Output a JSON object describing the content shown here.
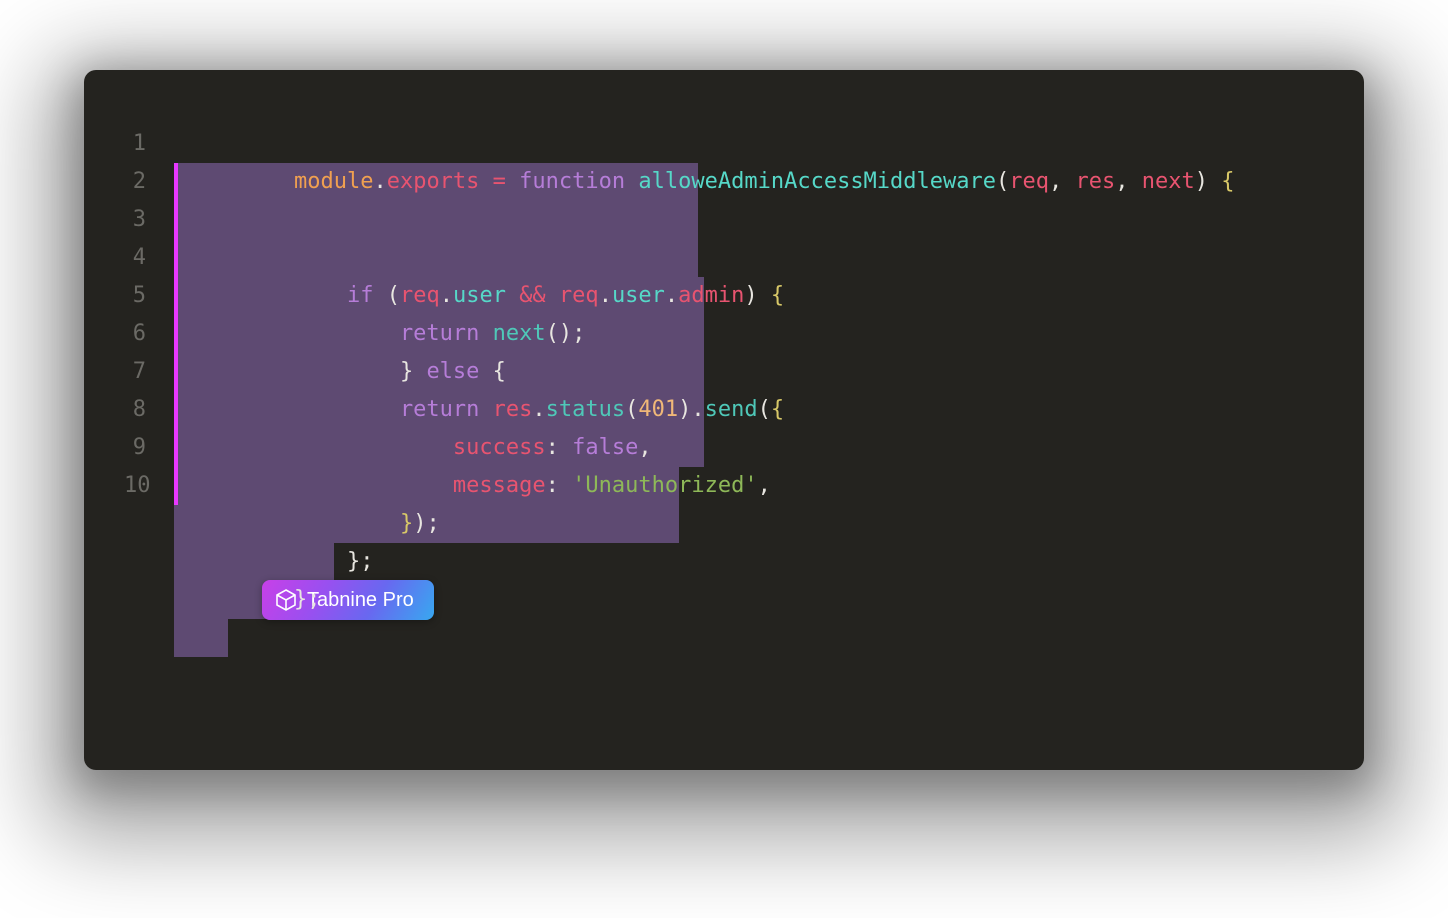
{
  "lineNumbers": [
    "1",
    "2",
    "3",
    "4",
    "5",
    "6",
    "7",
    "8",
    "9",
    "10"
  ],
  "code": {
    "l1": {
      "module": "module",
      "dot1": ".",
      "exports": "exports",
      "sp1": " ",
      "eq": "=",
      "sp2": " ",
      "function": "function",
      "sp3": " ",
      "fnName": "alloweAdminAccessMiddleware",
      "open": "(",
      "req": "req",
      "c1": ",",
      "sp4": " ",
      "res": "res",
      "c2": ",",
      "sp5": " ",
      "next": "next",
      "close": ")",
      "sp6": " ",
      "brace": "{"
    },
    "l2": {
      "indent": "    ",
      "if": "if",
      "sp1": " ",
      "open": "(",
      "req1": "req",
      "dot1": ".",
      "user1": "user",
      "sp2": " ",
      "and": "&&",
      "sp3": " ",
      "req2": "req",
      "dot2": ".",
      "user2": "user",
      "dot3": ".",
      "admin": "admin",
      "close": ")",
      "sp4": " ",
      "brace": "{"
    },
    "l3": {
      "indent": "        ",
      "return": "return",
      "sp1": " ",
      "next": "next",
      "open": "(",
      "close": ")",
      "semi": ";"
    },
    "l4": {
      "indent": "        ",
      "close": "}",
      "sp1": " ",
      "else": "else",
      "sp2": " ",
      "open": "{"
    },
    "l5": {
      "indent": "        ",
      "return": "return",
      "sp1": " ",
      "res": "res",
      "dot1": ".",
      "status": "status",
      "open1": "(",
      "code": "401",
      "close1": ")",
      "dot2": ".",
      "send": "send",
      "open2": "(",
      "brace": "{"
    },
    "l6": {
      "indent": "            ",
      "key": "success",
      "colon": ":",
      "sp": " ",
      "val": "false",
      "comma": ","
    },
    "l7": {
      "indent": "            ",
      "key": "message",
      "colon": ":",
      "sp": " ",
      "q1": "'",
      "val": "Unauthorized",
      "q2": "'",
      "comma": ","
    },
    "l8": {
      "indent": "        ",
      "brace": "}",
      "close": ")",
      "semi": ";"
    },
    "l9": {
      "indent": "    ",
      "close": "}",
      "semi": ";"
    },
    "l10": {
      "close": "}",
      "semi": ";"
    }
  },
  "highlightWidths": [
    "524px",
    "324px",
    "246px",
    "530px",
    "404px",
    "505px",
    "160px",
    "94px",
    "54px"
  ],
  "badge": {
    "label": "Tabnine Pro"
  }
}
